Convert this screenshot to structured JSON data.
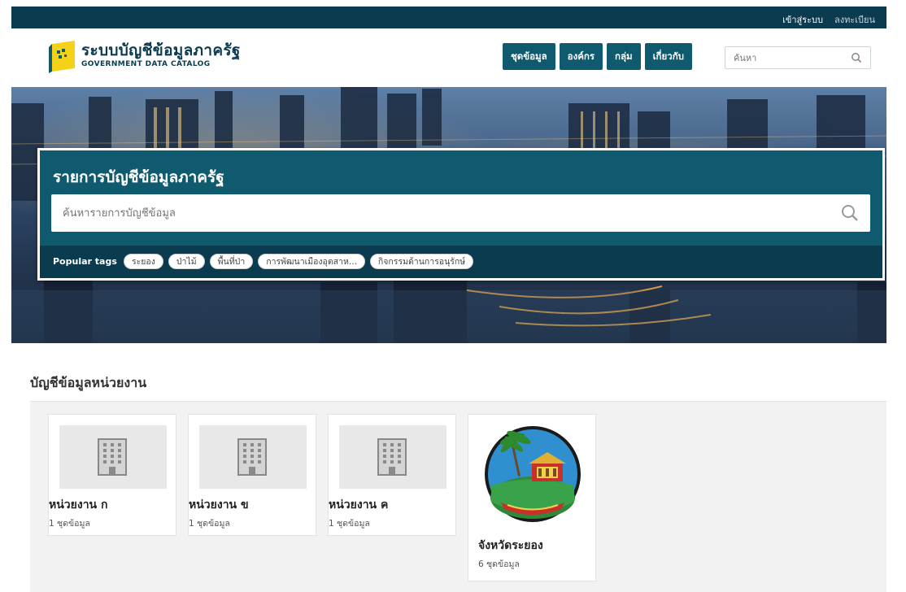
{
  "topbar": {
    "login": "เข้าสู่ระบบ",
    "register": "ลงทะเบียน"
  },
  "header": {
    "title": "ระบบบัญชีข้อมูลภาครัฐ",
    "subtitle": "GOVERNMENT DATA CATALOG",
    "nav": [
      "ชุดข้อมูล",
      "องค์กร",
      "กลุ่ม",
      "เกี่ยวกับ"
    ],
    "search_placeholder": "ค้นหา"
  },
  "hero": {
    "title": "รายการบัญชีข้อมูลภาครัฐ",
    "search_placeholder": "ค้นหารายการบัญชีข้อมูล",
    "tags_label": "Popular tags",
    "tags": [
      "ระยอง",
      "ป่าไม้",
      "พื้นที่ป่า",
      "การพัฒนาเมืองอุตสาห...",
      "กิจกรรมด้านการอนุรักษ์"
    ]
  },
  "organizations": {
    "title": "บัญชีข้อมูลหน่วยงาน",
    "items": [
      {
        "name": "หน่วยงาน ก",
        "count": "1 ชุดข้อมูล",
        "icon": "building-icon"
      },
      {
        "name": "หน่วยงาน ข",
        "count": "1 ชุดข้อมูล",
        "icon": "building-icon"
      },
      {
        "name": "หน่วยงาน ค",
        "count": "1 ชุดข้อมูล",
        "icon": "building-icon"
      },
      {
        "name": "จังหวัดระยอง",
        "count": "6 ชุดข้อมูล",
        "icon": "province-seal"
      }
    ]
  },
  "colors": {
    "brand_dark": "#0b3b4e",
    "brand": "#0f5a6e",
    "accent_yellow": "#f4d21a"
  }
}
